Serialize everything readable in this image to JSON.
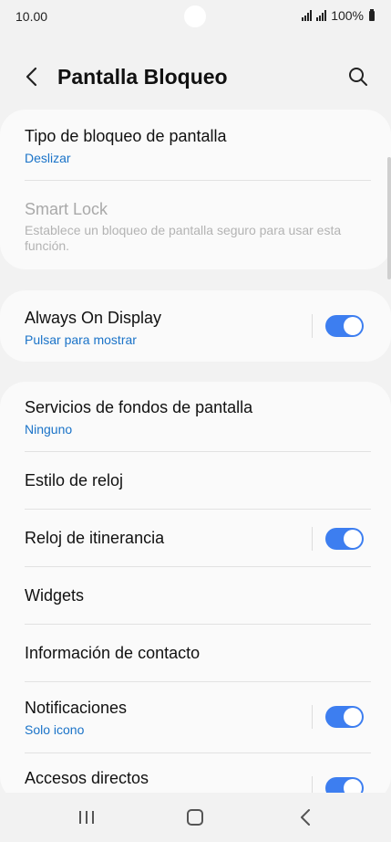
{
  "status": {
    "time": "10.00",
    "battery": "100%"
  },
  "header": {
    "title": "Pantalla Bloqueo"
  },
  "card1": {
    "screen_lock_type": {
      "title": "Tipo de bloqueo de pantalla",
      "value": "Deslizar"
    },
    "smart_lock": {
      "title": "Smart Lock",
      "desc": "Establece un bloqueo de pantalla seguro para usar esta función."
    }
  },
  "card2": {
    "always_on": {
      "title": "Always On Display",
      "value": "Pulsar para mostrar",
      "enabled": true
    }
  },
  "card3": {
    "wallpaper_services": {
      "title": "Servicios de fondos de pantalla",
      "value": "Ninguno"
    },
    "clock_style": {
      "title": "Estilo de reloj"
    },
    "roaming_clock": {
      "title": "Reloj de itinerancia",
      "enabled": true
    },
    "widgets": {
      "title": "Widgets"
    },
    "contact_info": {
      "title": "Información de contacto"
    },
    "notifications": {
      "title": "Notificaciones",
      "value": "Solo icono",
      "enabled": true
    },
    "shortcuts": {
      "title": "Accesos directos",
      "enabled": true
    }
  },
  "colors": {
    "accent": "#3d7ef0",
    "link": "#1a73c8",
    "background": "#f2f2f2",
    "card": "#fafafa"
  },
  "nav": {
    "icons": [
      "recent-apps-icon",
      "home-icon",
      "back-icon"
    ]
  }
}
